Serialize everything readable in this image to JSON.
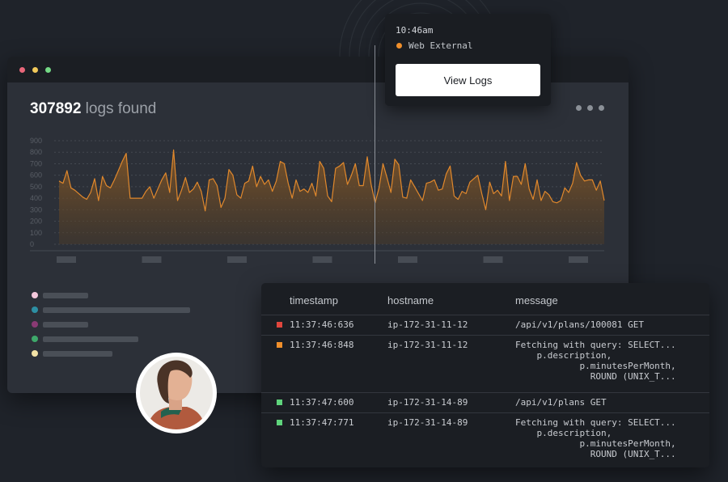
{
  "dashboard": {
    "count": "307892",
    "count_suffix": " logs found",
    "menu_icon": "more-horizontal-icon",
    "window_controls": [
      "close-dot",
      "minimize-dot",
      "maximize-dot"
    ]
  },
  "tooltip": {
    "time": "10:46am",
    "source": "Web External",
    "source_color": "#f08f2b",
    "button_label": "View Logs"
  },
  "chart_data": {
    "type": "area",
    "y_ticks": [
      0,
      100,
      200,
      300,
      400,
      500,
      600,
      700,
      800,
      900
    ],
    "ylim": [
      0,
      900
    ],
    "grid": true,
    "line_color": "#e0882c",
    "values": [
      550,
      530,
      640,
      490,
      470,
      440,
      410,
      390,
      450,
      570,
      380,
      590,
      510,
      490,
      560,
      640,
      720,
      790,
      400,
      400,
      400,
      400,
      460,
      500,
      400,
      480,
      560,
      620,
      450,
      820,
      380,
      470,
      580,
      450,
      480,
      540,
      460,
      290,
      560,
      570,
      510,
      320,
      400,
      650,
      600,
      430,
      400,
      530,
      550,
      680,
      500,
      590,
      520,
      560,
      460,
      550,
      720,
      700,
      530,
      400,
      560,
      460,
      480,
      450,
      530,
      420,
      720,
      660,
      420,
      370,
      660,
      680,
      710,
      520,
      600,
      700,
      510,
      510,
      760,
      520,
      360,
      490,
      700,
      580,
      450,
      740,
      690,
      410,
      400,
      560,
      500,
      440,
      380,
      530,
      540,
      560,
      470,
      480,
      610,
      680,
      420,
      390,
      460,
      440,
      540,
      570,
      600,
      440,
      300,
      540,
      440,
      470,
      420,
      720,
      380,
      590,
      590,
      520,
      700,
      480,
      390,
      560,
      380,
      460,
      430,
      370,
      360,
      380,
      490,
      450,
      530,
      710,
      600,
      550,
      560,
      560,
      470,
      550,
      380
    ]
  },
  "legend": {
    "colors": [
      "#f4c8dc",
      "#2d8fa3",
      "#8a3a74",
      "#3ea86a",
      "#f3e2a6"
    ]
  },
  "table": {
    "headers": {
      "timestamp": "timestamp",
      "hostname": "hostname",
      "message": "message"
    },
    "rows": [
      {
        "color": "#e0463d",
        "timestamp": "11:37:46:636",
        "hostname": "ip-172-31-11-12",
        "message": "/api/v1/plans/100081 GET"
      },
      {
        "color": "#f08f2b",
        "timestamp": "11:37:46:848",
        "hostname": "ip-172-31-11-12",
        "message": "Fetching with query: SELECT...\n    p.description,\n            p.minutesPerMonth,\n              ROUND (UNIX_T..."
      },
      {
        "color": "#5fd47c",
        "timestamp": "11:37:47:600",
        "hostname": "ip-172-31-14-89",
        "message": "/api/v1/plans GET"
      },
      {
        "color": "#5fd47c",
        "timestamp": "11:37:47:771",
        "hostname": "ip-172-31-14-89",
        "message": "Fetching with query: SELECT...\n    p.description,\n            p.minutesPerMonth,\n              ROUND (UNIX_T..."
      }
    ]
  }
}
